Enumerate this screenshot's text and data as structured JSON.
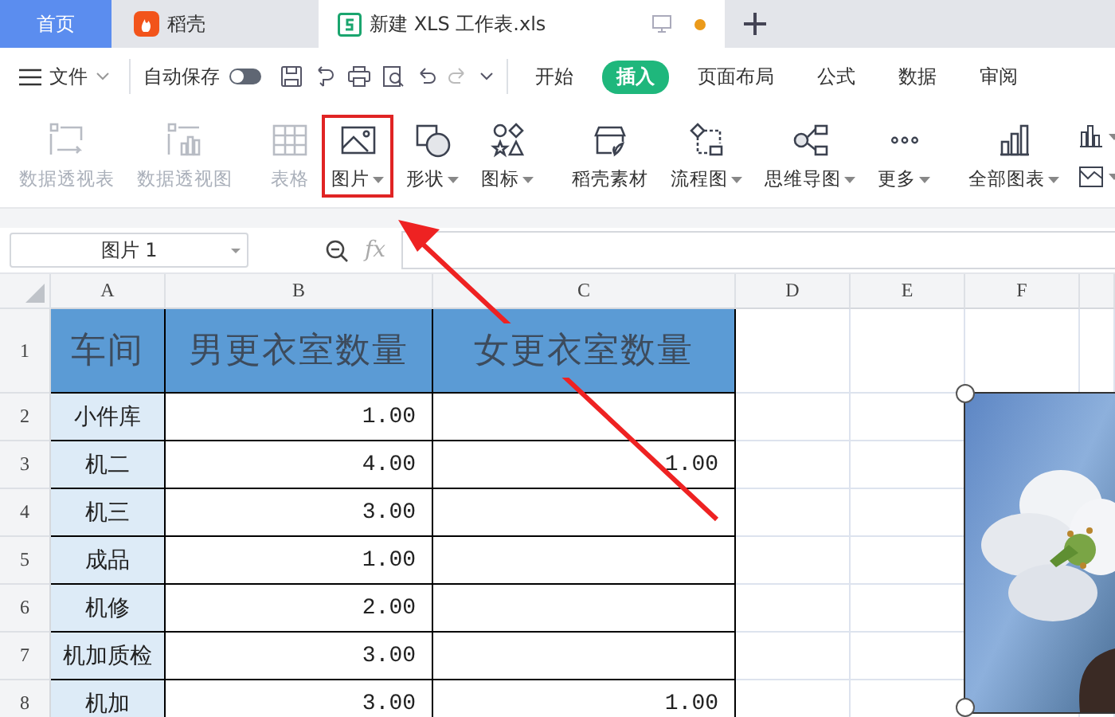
{
  "tabs": [
    {
      "label": "首页",
      "kind": "home",
      "selected": false
    },
    {
      "label": "稻壳",
      "kind": "docer",
      "selected": false
    },
    {
      "label": "新建 XLS 工作表.xls",
      "kind": "sheet",
      "selected": true,
      "unsaved": true
    }
  ],
  "toolbar": {
    "file_menu": "文件",
    "autosave": {
      "label": "自动保存",
      "on": false
    }
  },
  "menu_tabs": [
    {
      "label": "开始",
      "selected": false
    },
    {
      "label": "插入",
      "selected": true
    },
    {
      "label": "页面布局",
      "selected": false
    },
    {
      "label": "公式",
      "selected": false
    },
    {
      "label": "数据",
      "selected": false
    },
    {
      "label": "审阅",
      "selected": false
    }
  ],
  "ribbon": [
    [
      {
        "label": "数据透视表",
        "disabled": true,
        "dropdown": false,
        "highlighted": false
      },
      {
        "label": "数据透视图",
        "disabled": true,
        "dropdown": false,
        "highlighted": false
      }
    ],
    [
      {
        "label": "表格",
        "disabled": true,
        "dropdown": false,
        "highlighted": false
      },
      {
        "label": "图片",
        "disabled": false,
        "dropdown": true,
        "highlighted": true
      },
      {
        "label": "形状",
        "disabled": false,
        "dropdown": true,
        "highlighted": false
      },
      {
        "label": "图标",
        "disabled": false,
        "dropdown": true,
        "highlighted": false
      }
    ],
    [
      {
        "label": "稻壳素材",
        "disabled": false,
        "dropdown": false,
        "highlighted": false
      },
      {
        "label": "流程图",
        "disabled": false,
        "dropdown": true,
        "highlighted": false
      },
      {
        "label": "思维导图",
        "disabled": false,
        "dropdown": true,
        "highlighted": false
      },
      {
        "label": "更多",
        "disabled": false,
        "dropdown": true,
        "highlighted": false
      }
    ],
    [
      {
        "label": "全部图表",
        "disabled": false,
        "dropdown": true,
        "highlighted": false
      }
    ]
  ],
  "chart_shortcuts": [
    {
      "kind": "column",
      "dropdown": true
    },
    {
      "kind": "area",
      "dropdown": true
    }
  ],
  "name_box": "图片 1",
  "formula_label": "fx",
  "table": {
    "columns": [
      "A",
      "B",
      "C",
      "D",
      "E",
      "F"
    ],
    "header": {
      "number": "1",
      "cells": [
        "车间",
        "男更衣室数量",
        "女更衣室数量"
      ]
    },
    "rows": [
      {
        "number": "2",
        "cells": [
          "小件库",
          "1.00",
          null
        ]
      },
      {
        "number": "3",
        "cells": [
          "机二",
          "4.00",
          "1.00"
        ]
      },
      {
        "number": "4",
        "cells": [
          "机三",
          "3.00",
          null
        ]
      },
      {
        "number": "5",
        "cells": [
          "成品",
          "1.00",
          null
        ]
      },
      {
        "number": "6",
        "cells": [
          "机修",
          "2.00",
          null
        ]
      },
      {
        "number": "7",
        "cells": [
          "机加质检",
          "3.00",
          null
        ]
      },
      {
        "number": "8",
        "cells": [
          "机加",
          "3.00",
          "1.00"
        ]
      }
    ]
  },
  "inserted_picture": {
    "kind": "picture",
    "selected": true
  }
}
